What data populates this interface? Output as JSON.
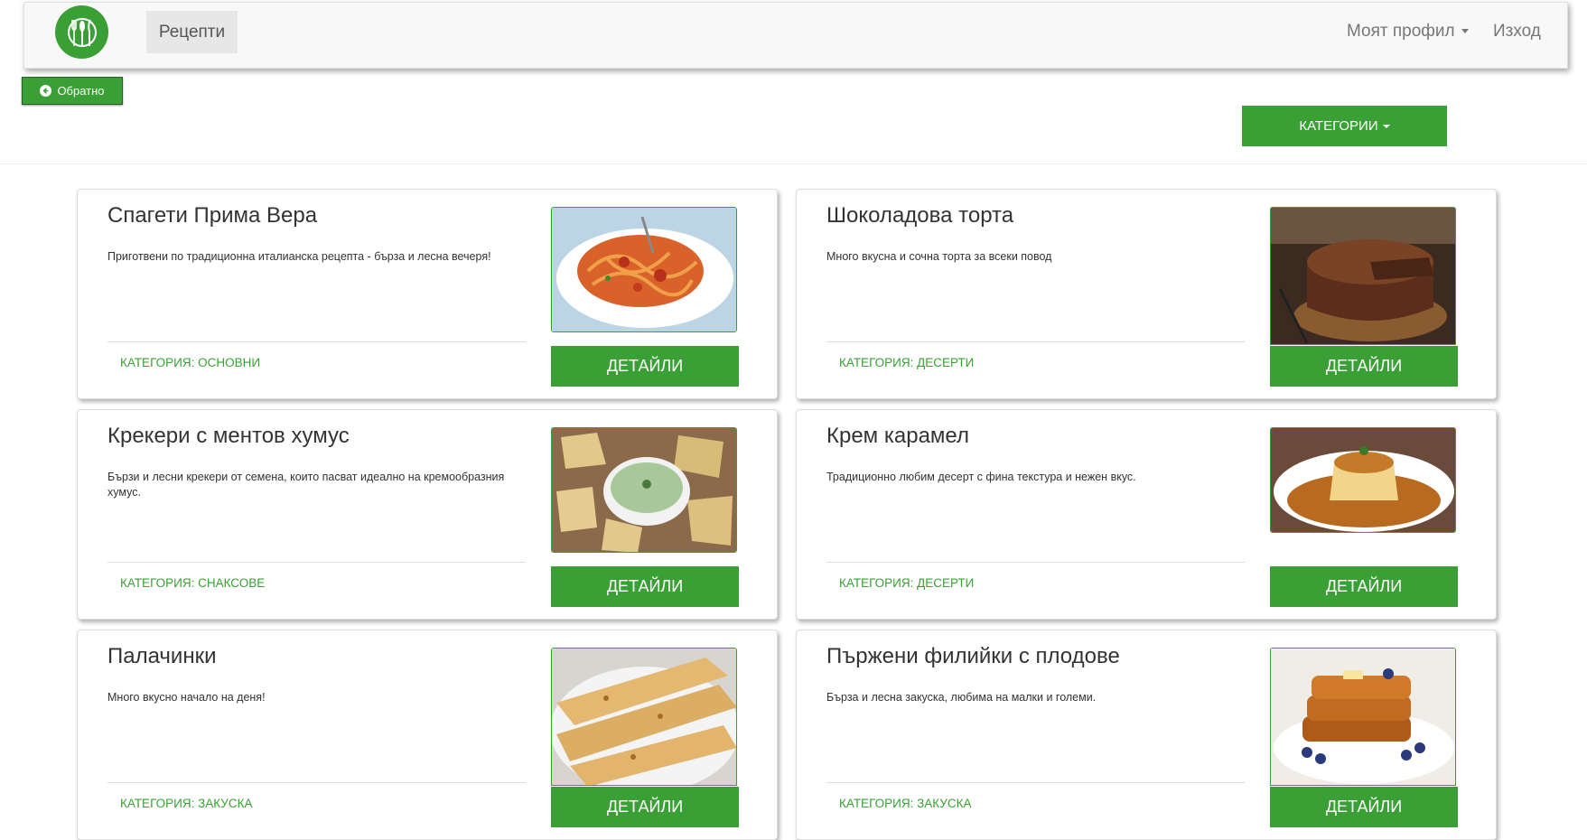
{
  "nav": {
    "logo_icon": "fork-knife-spoon-logo",
    "recipes_label": "Рецепти",
    "profile_label": "Моят профил",
    "logout_label": "Изход"
  },
  "toolbar": {
    "back_label": "Обратно",
    "categories_label": "КАТЕГОРИИ"
  },
  "colors": {
    "accent": "#3aa035",
    "nav_bg": "#f8f8f8"
  },
  "recipes": [
    {
      "title": "Спагети Прима Вера",
      "description": "Приготвени по традиционна италианска рецепта - бърза и лесна вечеря!",
      "category": "КАТЕГОРИЯ: ОСНОВНИ",
      "details_label": "ДЕТАЙЛИ",
      "image": "spaghetti-photo"
    },
    {
      "title": "Шоколадова торта",
      "description": "Много вкусна и сочна торта за всеки повод",
      "category": "КАТЕГОРИЯ: ДЕСЕРТИ",
      "details_label": "ДЕТАЙЛИ",
      "image": "chocolate-cake-photo"
    },
    {
      "title": "Крекери с ментов хумус",
      "description": "Бързи и лесни крекери от семена, които пасват идеално на кремообразния хумус.",
      "category": "КАТЕГОРИЯ: СНАКСОВЕ",
      "details_label": "ДЕТАЙЛИ",
      "image": "crackers-hummus-photo"
    },
    {
      "title": "Крем карамел",
      "description": "Традиционно любим десерт с фина текстура и нежен вкус.",
      "category": "КАТЕГОРИЯ: ДЕСЕРТИ",
      "details_label": "ДЕТАЙЛИ",
      "image": "creme-caramel-photo"
    },
    {
      "title": "Палачинки",
      "description": "Много вкусно начало на деня!",
      "category": "КАТЕГОРИЯ: ЗАКУСКА",
      "details_label": "ДЕТАЙЛИ",
      "image": "pancakes-photo"
    },
    {
      "title": "Пържени филийки с плодове",
      "description": "Бърза и лесна закуска, любима на малки и големи.",
      "category": "КАТЕГОРИЯ: ЗАКУСКА",
      "details_label": "ДЕТАЙЛИ",
      "image": "french-toast-photo"
    }
  ]
}
